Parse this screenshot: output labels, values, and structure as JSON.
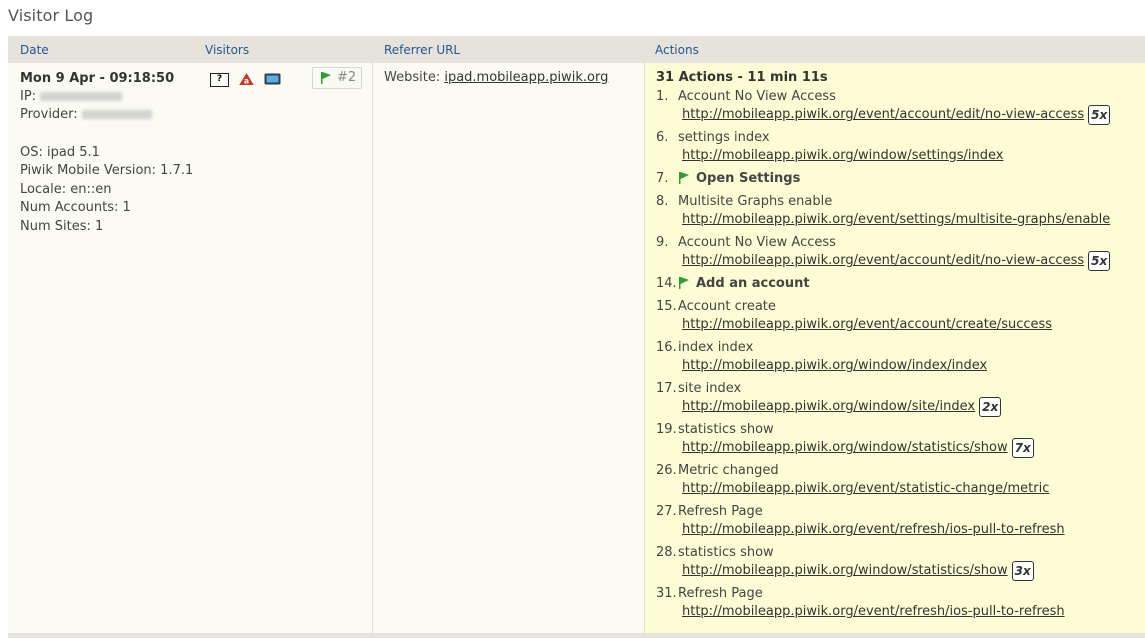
{
  "page": {
    "title": "Visitor Log"
  },
  "columns": {
    "date": "Date",
    "visitors": "Visitors",
    "referrer": "Referrer URL",
    "actions": "Actions"
  },
  "visit": {
    "date": "Mon 9 Apr - 09:18:50",
    "ip_label": "IP:",
    "provider_label": "Provider:",
    "os": "OS: ipad 5.1",
    "app_version": "Piwik Mobile Version: 1.7.1",
    "locale": "Locale: en::en",
    "num_accounts": "Num Accounts: 1",
    "num_sites": "Num Sites: 1",
    "visitor_icons": [
      "unknown-browser-icon",
      "os-icon",
      "screen-icon"
    ],
    "goal_count": "#2"
  },
  "referrer": {
    "label": "Website:",
    "url": "ipad.mobileapp.piwik.org"
  },
  "actions": {
    "summary": "31 Actions - 11 min 11s",
    "items": [
      {
        "num": "1.",
        "title": "Account No View Access",
        "url": "http://mobileapp.piwik.org/event/account/edit/no-view-access",
        "count": "5x"
      },
      {
        "num": "6.",
        "title": "settings index",
        "url": "http://mobileapp.piwik.org/window/settings/index",
        "count": ""
      },
      {
        "num": "7.",
        "title": "Open Settings",
        "goal": true
      },
      {
        "num": "8.",
        "title": "Multisite Graphs enable",
        "url": "http://mobileapp.piwik.org/event/settings/multisite-graphs/enable",
        "count": ""
      },
      {
        "num": "9.",
        "title": "Account No View Access",
        "url": "http://mobileapp.piwik.org/event/account/edit/no-view-access",
        "count": "5x"
      },
      {
        "num": "14.",
        "title": "Add an account",
        "goal": true
      },
      {
        "num": "15.",
        "title": "Account create",
        "url": "http://mobileapp.piwik.org/event/account/create/success",
        "count": ""
      },
      {
        "num": "16.",
        "title": "index index",
        "url": "http://mobileapp.piwik.org/window/index/index",
        "count": ""
      },
      {
        "num": "17.",
        "title": "site index",
        "url": "http://mobileapp.piwik.org/window/site/index",
        "count": "2x"
      },
      {
        "num": "19.",
        "title": "statistics show",
        "url": "http://mobileapp.piwik.org/window/statistics/show",
        "count": "7x"
      },
      {
        "num": "26.",
        "title": "Metric changed",
        "url": "http://mobileapp.piwik.org/event/statistic-change/metric",
        "count": ""
      },
      {
        "num": "27.",
        "title": "Refresh Page",
        "url": "http://mobileapp.piwik.org/event/refresh/ios-pull-to-refresh",
        "count": ""
      },
      {
        "num": "28.",
        "title": "statistics show",
        "url": "http://mobileapp.piwik.org/window/statistics/show",
        "count": "3x"
      },
      {
        "num": "31.",
        "title": "Refresh Page",
        "url": "http://mobileapp.piwik.org/event/refresh/ios-pull-to-refresh",
        "count": ""
      }
    ]
  },
  "colors": {
    "header_bg": "#e5e3dc",
    "header_text": "#255792",
    "actions_bg": "#fdfdd5",
    "goal_flag": "#2e9e2e"
  }
}
